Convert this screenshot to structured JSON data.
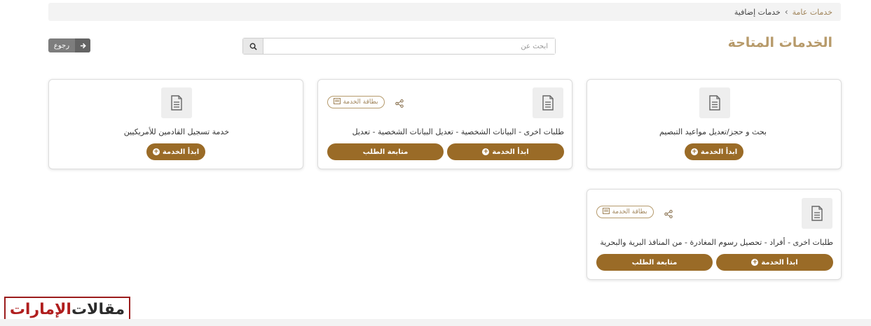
{
  "breadcrumb": {
    "parent": "خدمات عامة",
    "separator": "›",
    "current": "خدمات إضافية"
  },
  "page_title": "الخدمات المتاحة",
  "search": {
    "placeholder": "ابحث عن",
    "value": ""
  },
  "back_button": {
    "label": "رجوع"
  },
  "cards": [
    {
      "title": "بحث و حجز/تعديل مواعيد التبصيم",
      "start_label": "ابدأ الخدمة"
    },
    {
      "title": "طلبات اخرى - البيانات الشخصية - تعديل البيانات الشخصية - تعديل",
      "badge": "بطاقة الخدمة",
      "start_label": "ابدأ الخدمة",
      "follow_label": "متابعة الطلب"
    },
    {
      "title": "خدمة تسجيل القادمين للأمريكيين",
      "start_label": "ابدأ الخدمة"
    },
    {
      "title": "طلبات اخرى - أفراد - تحصيل رسوم المغادرة - من المنافذ البرية والبحرية",
      "badge": "بطاقة الخدمة",
      "start_label": "ابدأ الخدمة",
      "follow_label": "متابعة الطلب"
    }
  ],
  "watermark": {
    "part1": "مقالات",
    "part2": "الإمارات"
  },
  "colors": {
    "accent": "#9a6b27",
    "title": "#b79a6a",
    "watermark_red": "#b01e1e"
  },
  "icons": [
    "search-icon",
    "arrow-right-icon",
    "document-icon",
    "share-icon",
    "card-icon",
    "plus-circle-icon"
  ]
}
